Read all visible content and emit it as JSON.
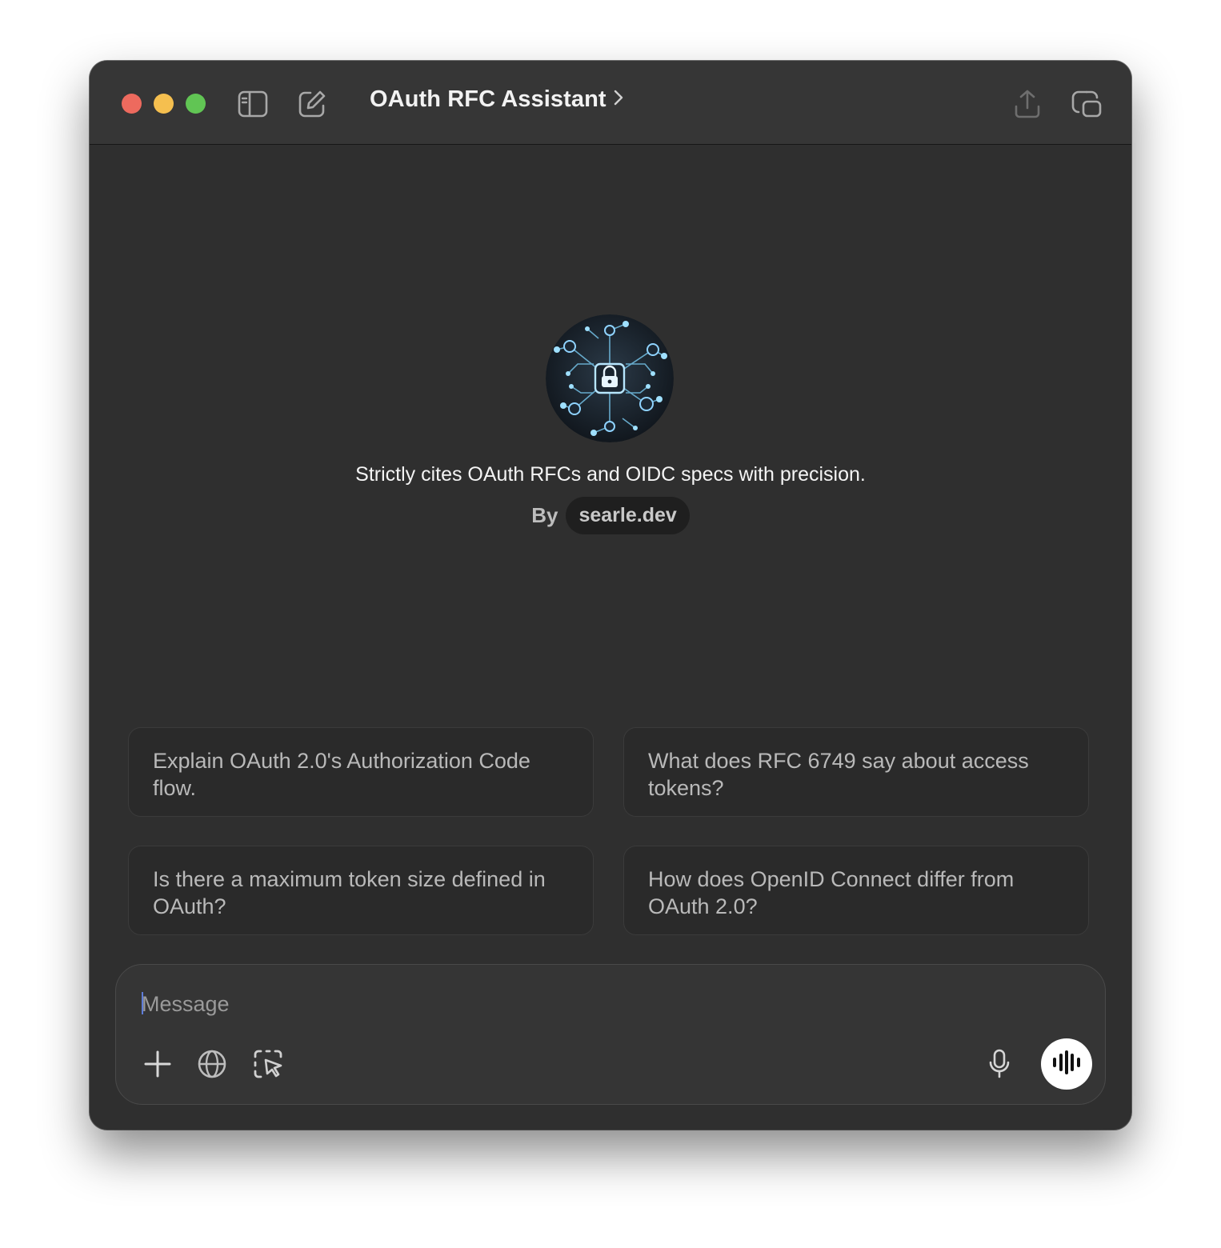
{
  "window": {
    "title": "OAuth RFC Assistant",
    "title_chevron": "chevron-right-icon"
  },
  "toolbar": {
    "icons": [
      "sidebar-toggle-icon",
      "new-chat-icon",
      "share-icon",
      "new-window-icon"
    ]
  },
  "gpt": {
    "avatar_icon": "circuit-lock-icon",
    "description": "Strictly cites OAuth RFCs and OIDC specs with precision.",
    "by_label": "By",
    "author": "searle.dev"
  },
  "suggestions": [
    "Explain OAuth 2.0's Authorization Code flow.",
    "What does RFC 6749 say about access tokens?",
    "Is there a maximum token size defined in OAuth?",
    "How does OpenID Connect differ from OAuth 2.0?"
  ],
  "composer": {
    "placeholder": "Message",
    "value": "",
    "icons": [
      "plus-icon",
      "globe-icon",
      "screen-select-icon",
      "microphone-icon",
      "voice-waveform-icon"
    ]
  },
  "colors": {
    "window_bg": "#2f2f2f",
    "titlebar_bg": "#363636",
    "close": "#ed6a5e",
    "minimize": "#f5bf4f",
    "zoom": "#61c554",
    "avatar_accent": "#5ec8ff"
  }
}
